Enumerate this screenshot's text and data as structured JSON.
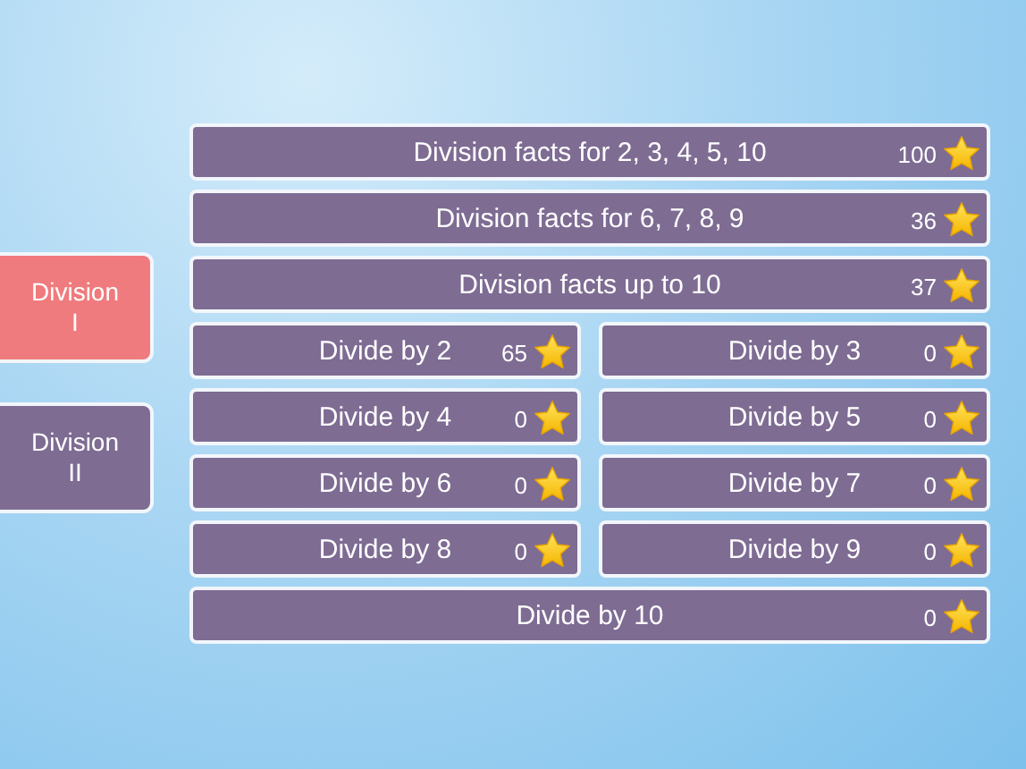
{
  "tabs": [
    {
      "label": "Division\nI",
      "selected": true
    },
    {
      "label": "Division\nII",
      "selected": false
    }
  ],
  "exercises": [
    {
      "title": "Division facts for 2, 3, 4, 5, 10",
      "score": "100",
      "wide": true
    },
    {
      "title": "Division facts for 6, 7, 8, 9",
      "score": "36",
      "wide": true
    },
    {
      "title": "Division facts up to 10",
      "score": "37",
      "wide": true
    },
    {
      "title": "Divide by 2",
      "score": "65",
      "wide": false
    },
    {
      "title": "Divide by 3",
      "score": "0",
      "wide": false
    },
    {
      "title": "Divide by 4",
      "score": "0",
      "wide": false
    },
    {
      "title": "Divide by 5",
      "score": "0",
      "wide": false
    },
    {
      "title": "Divide by 6",
      "score": "0",
      "wide": false
    },
    {
      "title": "Divide by 7",
      "score": "0",
      "wide": false
    },
    {
      "title": "Divide by 8",
      "score": "0",
      "wide": false
    },
    {
      "title": "Divide by 9",
      "score": "0",
      "wide": false
    },
    {
      "title": "Divide by 10",
      "score": "0",
      "wide": true
    }
  ]
}
